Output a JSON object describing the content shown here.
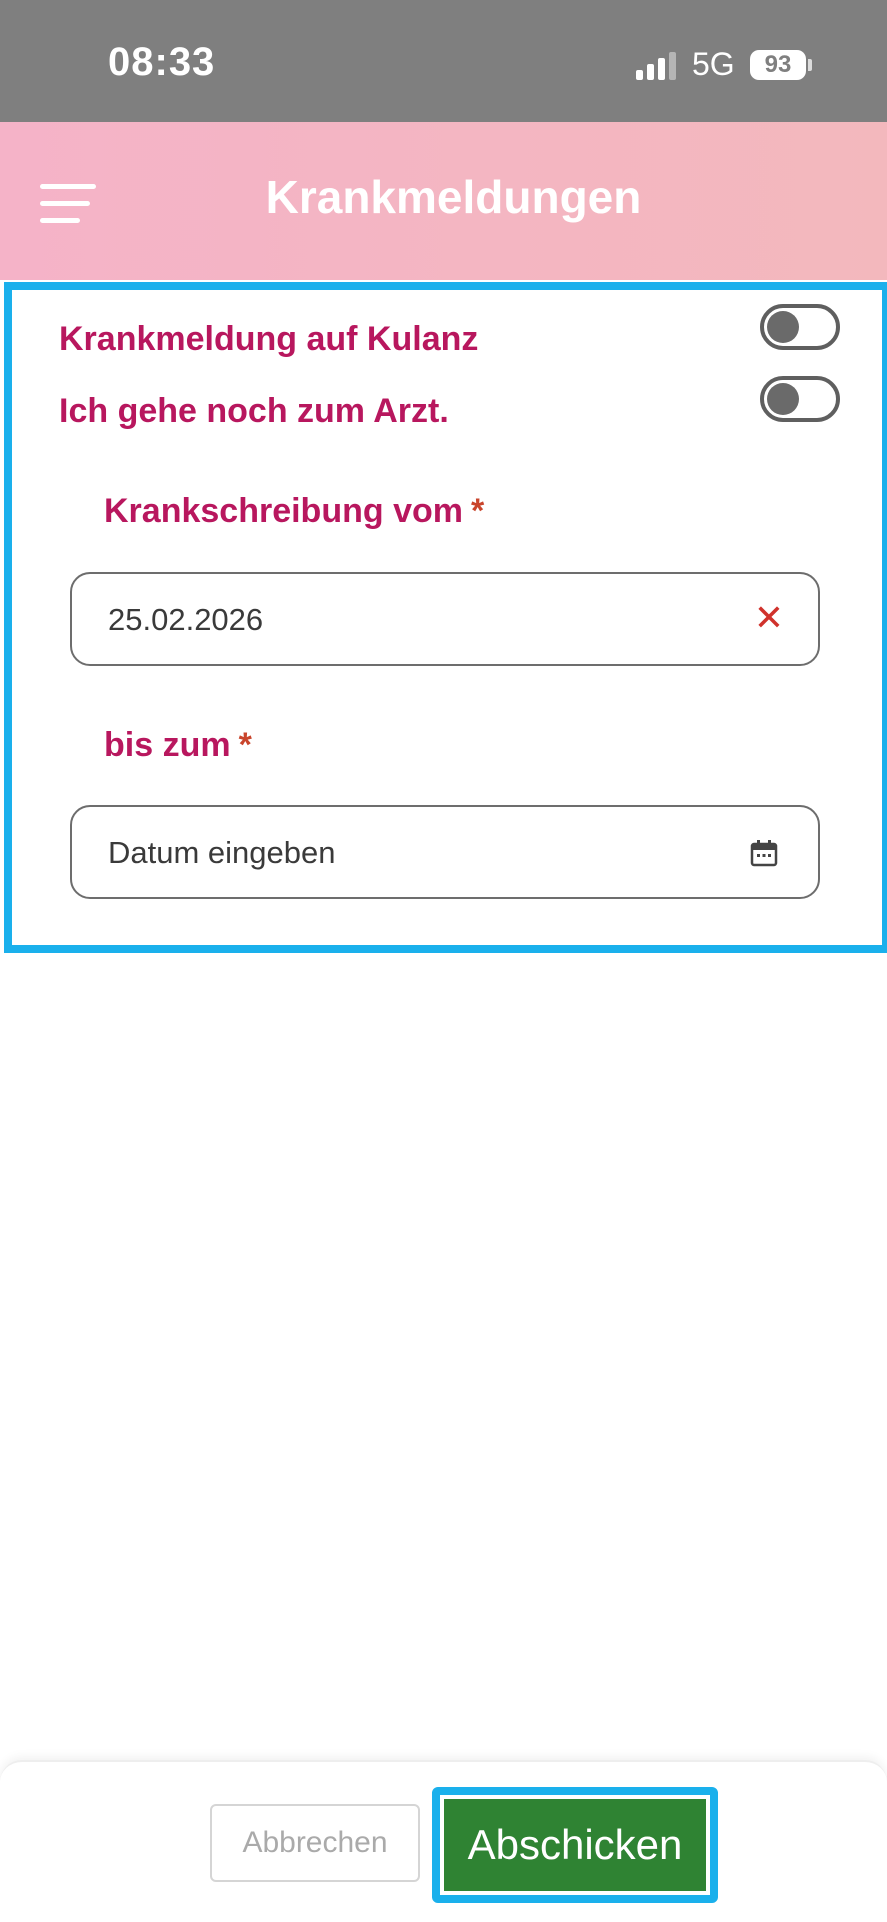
{
  "status_bar": {
    "time": "08:33",
    "network": "5G",
    "battery": "93",
    "icons": [
      "signal-icon",
      "battery-icon"
    ]
  },
  "header": {
    "title": "Krankmeldungen",
    "menu_icon": "hamburger-menu-icon"
  },
  "form": {
    "toggles": [
      {
        "label": "Krankmeldung auf Kulanz",
        "state": "off"
      },
      {
        "label": "Ich gehe noch zum Arzt.",
        "state": "off"
      }
    ],
    "from_field": {
      "label": "Krankschreibung vom",
      "required_marker": "*",
      "value": "25.02.2026",
      "clear_icon": "✕"
    },
    "to_field": {
      "label": "bis zum",
      "required_marker": "*",
      "placeholder": "Datum eingeben",
      "icon": "calendar-icon"
    }
  },
  "actions": {
    "cancel_label": "Abbrechen",
    "submit_label": "Abschicken"
  },
  "colors": {
    "accent": "#b8175e",
    "header_bg": "#f5b3c8",
    "submit_bg": "#2f8333",
    "highlight_border": "#1ab0ec",
    "status_bar_bg": "#7f7f7f"
  }
}
